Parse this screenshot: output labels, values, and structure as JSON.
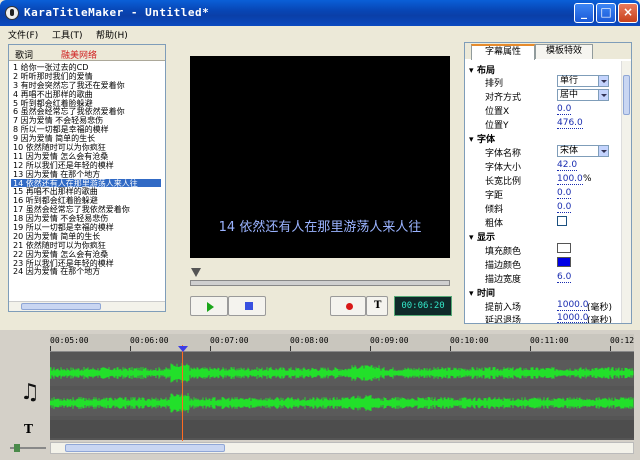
{
  "window": {
    "title": "KaraTitleMaker - Untitled*"
  },
  "menu": [
    "文件(F)",
    "工具(T)",
    "帮助(H)"
  ],
  "lyrics": {
    "header_label": "歌词",
    "header_sub": "融美网络",
    "selected_index": 13,
    "rows": [
      "1 给你一张过去的CD",
      "2 听听那时我们的爱情",
      "3 有时会突然忘了我还在爱着你",
      "4 再唱不出那样的歌曲",
      "5 听到都会红着脸躲避",
      "6 虽然会经常忘了我依然爱着你",
      "7 因为爱情 不会轻易悲伤",
      "8 所以一切都是幸福的模样",
      "9 因为爱情 简单的生长",
      "10 依然随时可以为你疯狂",
      "11 因为爱情 怎么会有沧桑",
      "12 所以我们还是年轻的模样",
      "13 因为爱情 在那个地方",
      "14 依然还有人在那里游荡人来人往",
      "15 再唱不出那样的歌曲",
      "16 听到都会红着脸躲避",
      "17 虽然会经常忘了我依然爱着你",
      "18 因为爱情 不会轻易悲伤",
      "19 所以一切都是幸福的模样",
      "20 因为爱情 简单的生长",
      "21 依然随时可以为你疯狂",
      "22 因为爱情 怎么会有沧桑",
      "23 所以我们还是年轻的模样",
      "24 因为爱情 在那个地方"
    ]
  },
  "preview": {
    "text": "14 依然还有人在那里游荡人来人往"
  },
  "playback": {
    "time": "00:06:20",
    "record_t_label": "T"
  },
  "props": {
    "tabs": [
      "字幕属性",
      "模板特效"
    ],
    "layout_section": "布局",
    "arrange_label": "排列",
    "arrange_value": "单行",
    "align_label": "对齐方式",
    "align_value": "居中",
    "posx_label": "位置X",
    "posx_value": "0.0",
    "posy_label": "位置Y",
    "posy_value": "476.0",
    "font_section": "字体",
    "fontname_label": "字体名称",
    "fontname_value": "宋体",
    "fontsize_label": "字体大小",
    "fontsize_value": "42.0",
    "ratio_label": "长宽比例",
    "ratio_value": "100.0",
    "ratio_unit": "%",
    "spacing_label": "字距",
    "spacing_value": "0.0",
    "italic_label": "倾斜",
    "italic_value": "0.0",
    "bold_label": "粗体",
    "display_section": "显示",
    "fill_label": "填充颜色",
    "fill_color": "#ffffff",
    "stroke_label": "描边颜色",
    "stroke_color": "#0000e6",
    "strokew_label": "描边宽度",
    "strokew_value": "6.0",
    "time_section": "时间",
    "advance_label": "提前入场",
    "advance_value": "1000.0",
    "advance_unit": "(毫秒)",
    "delay_label": "延迟退场",
    "delay_value": "1000.0",
    "delay_unit": "(毫秒)"
  },
  "timeline": {
    "ticks": [
      "00:05:00",
      "00:06:00",
      "00:07:00",
      "00:08:00",
      "00:09:00",
      "00:10:00",
      "00:11:00",
      "00:12"
    ]
  },
  "colors": {
    "waveform": "#22e02a",
    "playhead": "#ff6a22",
    "preview_text": "#9ab3ff"
  }
}
